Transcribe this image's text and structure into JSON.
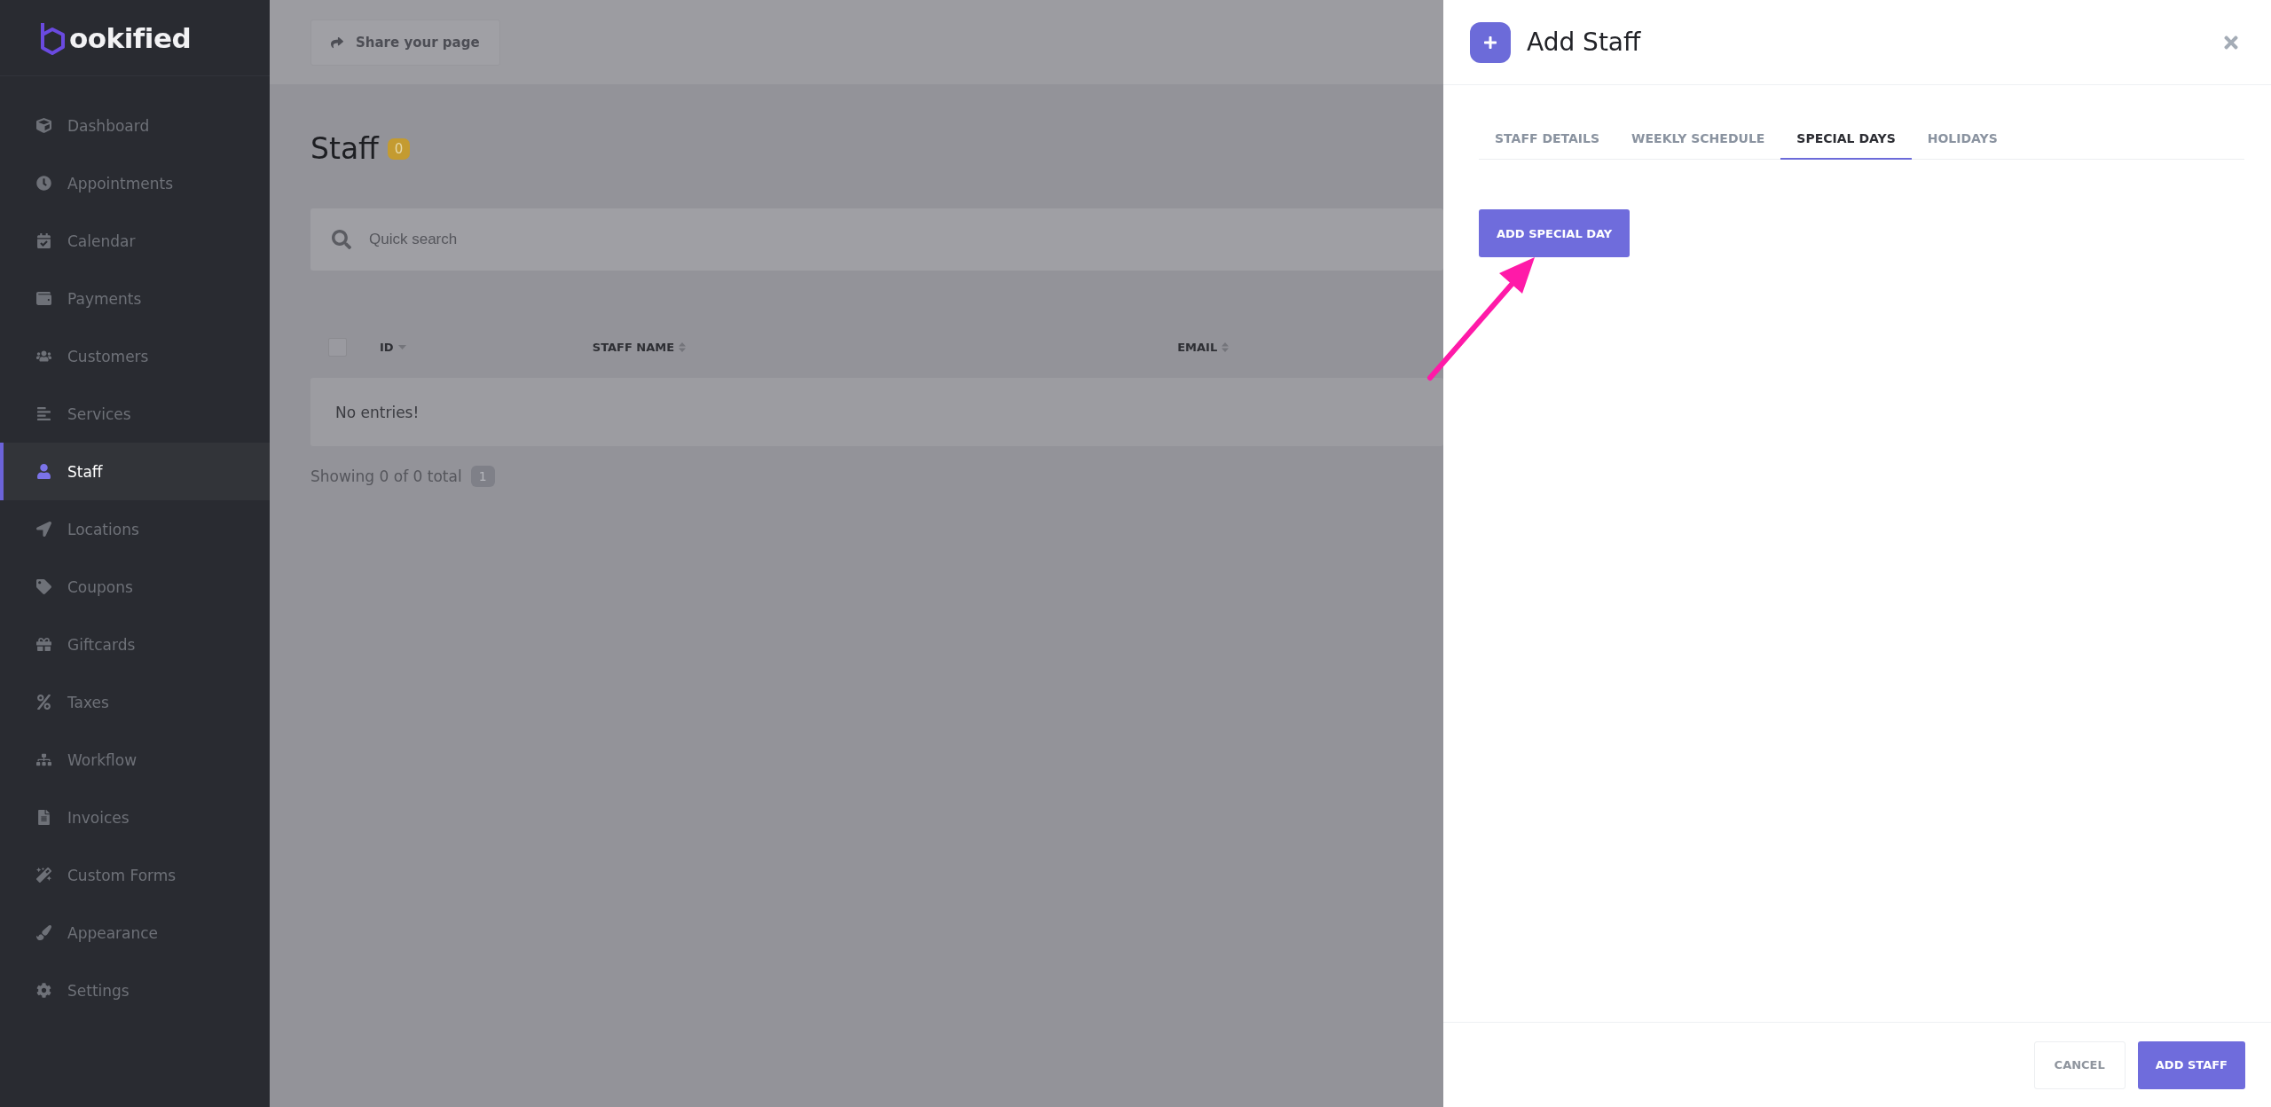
{
  "sidebar": {
    "logo": "ookified",
    "items": [
      {
        "label": "Dashboard",
        "selected": false
      },
      {
        "label": "Appointments",
        "selected": false
      },
      {
        "label": "Calendar",
        "selected": false
      },
      {
        "label": "Payments",
        "selected": false
      },
      {
        "label": "Customers",
        "selected": false
      },
      {
        "label": "Services",
        "selected": false
      },
      {
        "label": "Staff",
        "selected": true
      },
      {
        "label": "Locations",
        "selected": false
      },
      {
        "label": "Coupons",
        "selected": false
      },
      {
        "label": "Giftcards",
        "selected": false
      },
      {
        "label": "Taxes",
        "selected": false
      },
      {
        "label": "Workflow",
        "selected": false
      },
      {
        "label": "Invoices",
        "selected": false
      },
      {
        "label": "Custom Forms",
        "selected": false
      },
      {
        "label": "Appearance",
        "selected": false
      },
      {
        "label": "Settings",
        "selected": false
      }
    ]
  },
  "topbar": {
    "share_button": "Share your page"
  },
  "page": {
    "title": "Staff",
    "count": "0",
    "search": {
      "placeholder": "Quick search"
    },
    "table": {
      "select_all": {
        "checked": false
      },
      "columns": [
        {
          "label": "ID",
          "sorted": true
        },
        {
          "label": "STAFF NAME",
          "sorted": false
        },
        {
          "label": "EMAIL",
          "sorted": false
        }
      ],
      "empty": "No entries!"
    },
    "footer": {
      "summary": "Showing 0 of 0 total",
      "page": "1"
    }
  },
  "panel": {
    "title": "Add Staff",
    "tabs": [
      {
        "label": "STAFF DETAILS",
        "selected": false
      },
      {
        "label": "WEEKLY SCHEDULE",
        "selected": false
      },
      {
        "label": "SPECIAL DAYS",
        "selected": true
      },
      {
        "label": "HOLIDAYS",
        "selected": false
      }
    ],
    "add_button": "ADD SPECIAL DAY",
    "cancel_button": "CANCEL",
    "submit_button": "ADD STAFF"
  }
}
